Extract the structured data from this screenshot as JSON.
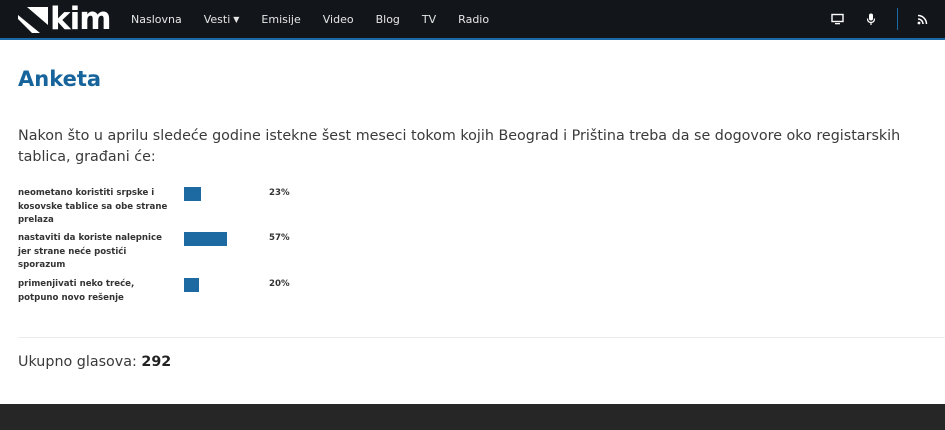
{
  "brand": {
    "logo_text": "kim",
    "colors": {
      "navbar": "#121519",
      "accent": "#1a6aa8",
      "title": "#17649c",
      "bar": "#1d6aa3",
      "footer": "#262626"
    }
  },
  "nav": {
    "items": [
      {
        "label": "Naslovna"
      },
      {
        "label": "Vesti",
        "has_dropdown": true
      },
      {
        "label": "Emisije"
      },
      {
        "label": "Video"
      },
      {
        "label": "Blog"
      },
      {
        "label": "TV"
      },
      {
        "label": "Radio"
      }
    ],
    "right_icons": [
      "tv-icon",
      "microphone-icon",
      "rss-icon"
    ]
  },
  "poll": {
    "title": "Anketa",
    "question": "Nakon što u aprilu sledeće godine istekne šest meseci tokom kojih Beograd i Priština treba da se dogovore oko registarskih tablica, građani će:",
    "options": [
      {
        "label": "neometano koristiti srpske i kosovske tablice sa obe strane prelaza",
        "percent_label": "23%",
        "percent": 23
      },
      {
        "label": "nastaviti da koriste nalepnice jer strane neće postići sporazum",
        "percent_label": "57%",
        "percent": 57
      },
      {
        "label": "primenjivati neko treće, potpuno novo rešenje",
        "percent_label": "20%",
        "percent": 20
      }
    ],
    "total_label": "Ukupno glasova:",
    "total_value": "292"
  }
}
